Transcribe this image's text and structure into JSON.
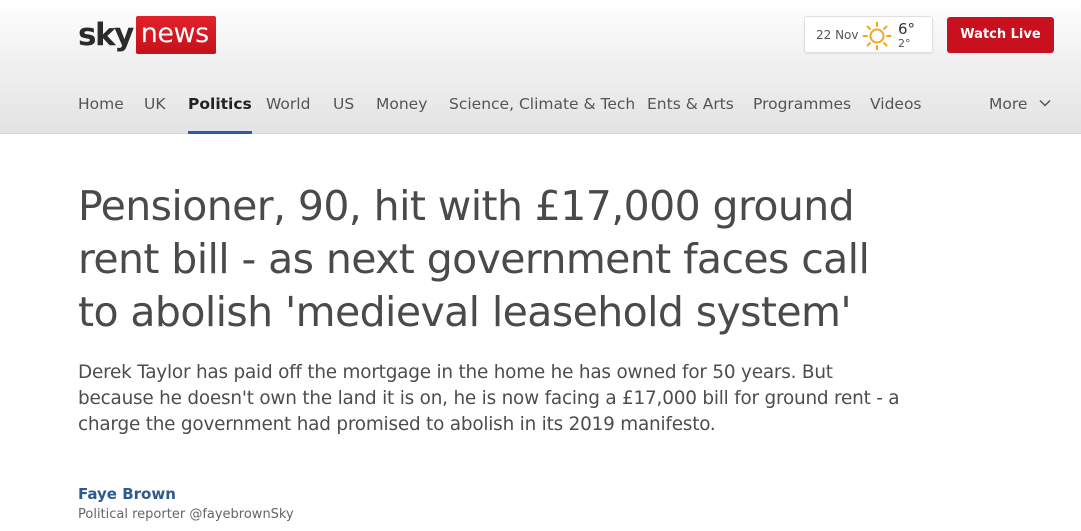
{
  "brand": {
    "sky": "sky",
    "news": "news",
    "news_color": "#d51c24"
  },
  "weather": {
    "date": "22 Nov",
    "high": "6°",
    "low": "2°",
    "icon": "sun-icon"
  },
  "header": {
    "watch_live_label": "Watch Live",
    "watch_live_color": "#c8101e"
  },
  "nav": {
    "items": [
      {
        "label": "Home"
      },
      {
        "label": "UK"
      },
      {
        "label": "Politics",
        "active": true
      },
      {
        "label": "World"
      },
      {
        "label": "US"
      },
      {
        "label": "Money"
      },
      {
        "label": "Science, Climate & Tech"
      },
      {
        "label": "Ents & Arts"
      },
      {
        "label": "Programmes"
      },
      {
        "label": "Videos"
      }
    ],
    "more_label": "More",
    "active_color": "#2e5aa8"
  },
  "article": {
    "headline_lines": [
      "Pensioner, 90, hit with £17,000 ground",
      "rent bill - as next government faces call",
      "to abolish 'medieval leasehold system'"
    ],
    "standfirst_lines": [
      "Derek Taylor has paid off the mortgage in the home he has owned for 50 years. But",
      "because he doesn't own the land it is on, he is now facing a £17,000 bill for ground rent - a",
      "charge the government had promised to abolish in its 2019 manifesto."
    ],
    "author": {
      "name": "Faye Brown",
      "role": "Political reporter",
      "handle": "@fayebrownSky"
    }
  }
}
